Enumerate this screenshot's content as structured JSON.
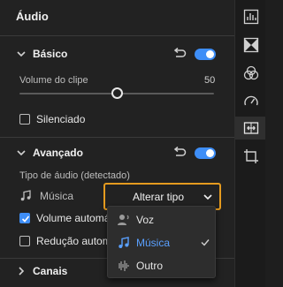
{
  "panel": {
    "title": "Áudio"
  },
  "basic": {
    "title": "Básico",
    "volume_label": "Volume do clipe",
    "volume_value": "50",
    "volume_level": 50,
    "mute_label": "Silenciado",
    "mute_checked": false,
    "enabled": true
  },
  "advanced": {
    "title": "Avançado",
    "audio_type_label": "Tipo de áudio (detectado)",
    "detected_type": "Música",
    "change_type_label": "Alterar tipo",
    "auto_volume_label": "Volume automático",
    "auto_volume_checked": true,
    "auto_ducking_label": "Redução automática",
    "auto_ducking_checked": false,
    "enabled": true
  },
  "dropdown_menu": {
    "items": [
      {
        "label": "Voz",
        "icon": "voice-icon",
        "selected": false
      },
      {
        "label": "Música",
        "icon": "music-note-icon",
        "selected": true
      },
      {
        "label": "Outro",
        "icon": "waveform-icon",
        "selected": false
      }
    ]
  },
  "channels": {
    "title": "Canais"
  },
  "rail": {
    "icons": [
      "audio-meter-icon",
      "transitions-icon",
      "color-icon",
      "speed-icon",
      "audio-trim-icon",
      "crop-icon"
    ],
    "active": "audio-trim-icon"
  },
  "colors": {
    "accent": "#3e8ef7",
    "focus_outline": "#e59b1f",
    "background": "#222222"
  }
}
